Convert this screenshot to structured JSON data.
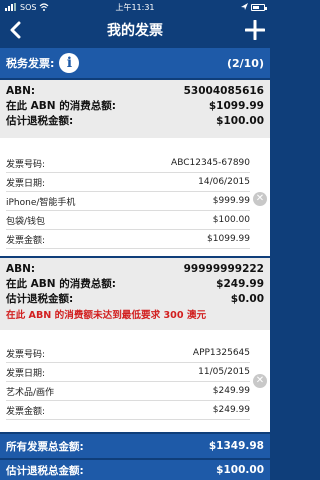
{
  "status": {
    "left": "SOS",
    "time": "上午11:31"
  },
  "nav": {
    "title": "我的发票"
  },
  "tax": {
    "label": "税务发票:",
    "info_icon": "i",
    "count": "(2/10)"
  },
  "invoices": [
    {
      "abn_label": "ABN:",
      "abn_value": "53004085616",
      "total_label": "在此 ABN 的消费总额:",
      "total_value": "$1099.99",
      "refund_label": "估计退税金额:",
      "refund_value": "$100.00",
      "warning": "",
      "details": [
        {
          "label": "发票号码:",
          "value": "ABC12345-67890"
        },
        {
          "label": "发票日期:",
          "value": "14/06/2015"
        },
        {
          "label": "iPhone/智能手机",
          "value": "$999.99"
        },
        {
          "label": "包袋/钱包",
          "value": "$100.00"
        },
        {
          "label": "发票金额:",
          "value": "$1099.99"
        }
      ]
    },
    {
      "abn_label": "ABN:",
      "abn_value": "99999999222",
      "total_label": "在此 ABN 的消费总额:",
      "total_value": "$249.99",
      "refund_label": "估计退税金额:",
      "refund_value": "$0.00",
      "warning": "在此 ABN 的消费额未达到最低要求 300 澳元",
      "details": [
        {
          "label": "发票号码:",
          "value": "APP1325645"
        },
        {
          "label": "发票日期:",
          "value": "11/05/2015"
        },
        {
          "label": "艺术品/画作",
          "value": "$249.99"
        },
        {
          "label": "发票金额:",
          "value": "$249.99"
        }
      ]
    }
  ],
  "totals": {
    "all_label": "所有发票总金额:",
    "all_value": "$1349.98",
    "refund_label": "估计退税总金额:",
    "refund_value": "$100.00"
  },
  "colors": {
    "nav": "#0f3e7a",
    "bar": "#1e5aa8",
    "warning": "#d21f1f"
  }
}
